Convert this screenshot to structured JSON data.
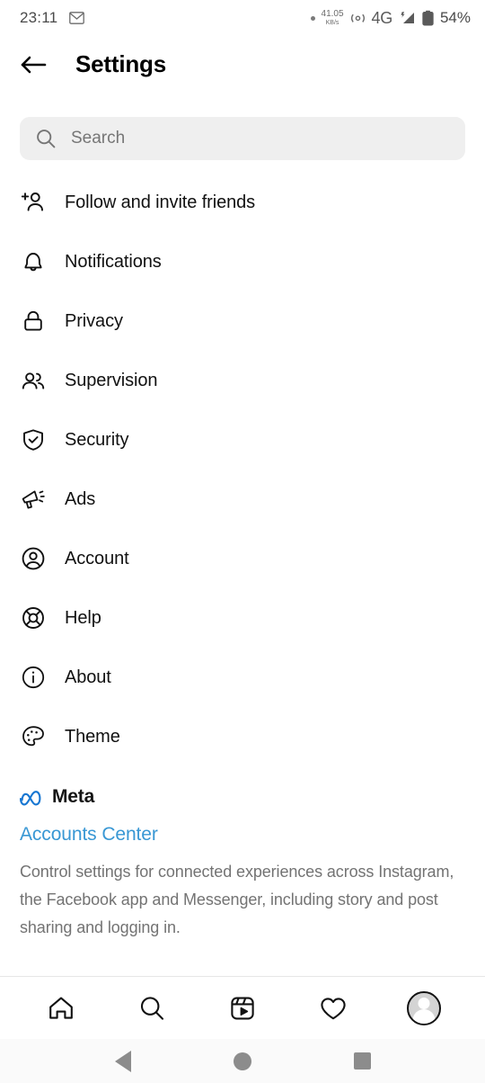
{
  "status_bar": {
    "time": "23:11",
    "app_icon": "gmail-icon",
    "data_rate_value": "41.05",
    "data_rate_unit": "KB/s",
    "network_type": "4G",
    "battery_percent": "54%"
  },
  "header": {
    "back_label": "Back",
    "title": "Settings"
  },
  "search": {
    "placeholder": "Search",
    "value": ""
  },
  "menu": {
    "items": [
      {
        "label": "Follow and invite friends",
        "icon": "person-add-icon"
      },
      {
        "label": "Notifications",
        "icon": "bell-icon"
      },
      {
        "label": "Privacy",
        "icon": "lock-icon"
      },
      {
        "label": "Supervision",
        "icon": "people-icon"
      },
      {
        "label": "Security",
        "icon": "shield-check-icon"
      },
      {
        "label": "Ads",
        "icon": "megaphone-icon"
      },
      {
        "label": "Account",
        "icon": "account-circle-icon"
      },
      {
        "label": "Help",
        "icon": "lifebuoy-icon"
      },
      {
        "label": "About",
        "icon": "info-circle-icon"
      },
      {
        "label": "Theme",
        "icon": "palette-icon"
      }
    ]
  },
  "meta_section": {
    "brand": "Meta",
    "brand_icon": "meta-infinity-logo",
    "link": "Accounts Center",
    "link_color": "#3897d4",
    "description": "Control settings for connected experiences across Instagram, the Facebook app and Messenger, including story and post sharing and logging in."
  },
  "bottom_nav": {
    "items": [
      {
        "name": "home",
        "icon": "home-icon"
      },
      {
        "name": "search",
        "icon": "magnifier-icon"
      },
      {
        "name": "reels",
        "icon": "reels-icon"
      },
      {
        "name": "activity",
        "icon": "heart-icon"
      },
      {
        "name": "profile",
        "icon": "avatar-icon"
      }
    ]
  },
  "system_nav": {
    "back": "back-triangle-icon",
    "home": "home-circle-icon",
    "recents": "recents-square-icon"
  }
}
